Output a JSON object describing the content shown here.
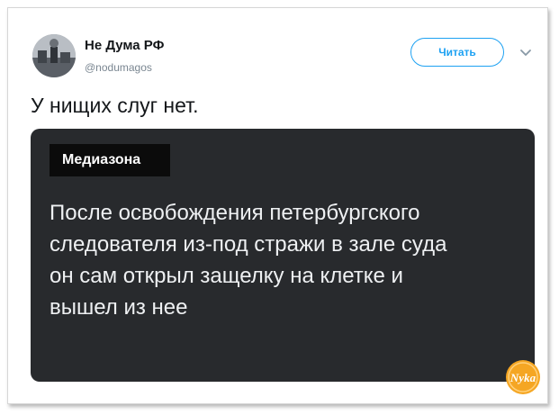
{
  "tweet": {
    "author_name": "Не Дума РФ",
    "author_handle": "@nodumagos",
    "follow_label": "Читать",
    "text": "У нищих слуг нет."
  },
  "media_card": {
    "brand": "Медиазона",
    "headline": "После освобождения петербургского\nследователя из-под стражи в зале суда\nон сам открыл защелку на клетке и\nвышел из нее"
  },
  "watermark": {
    "text": "Nyka"
  },
  "icons": {
    "avatar": "avatar-photo",
    "menu": "chevron-down-icon"
  },
  "colors": {
    "accent": "#1da1f2",
    "card_bg": "#282a2d",
    "watermark": "#f5a623"
  }
}
